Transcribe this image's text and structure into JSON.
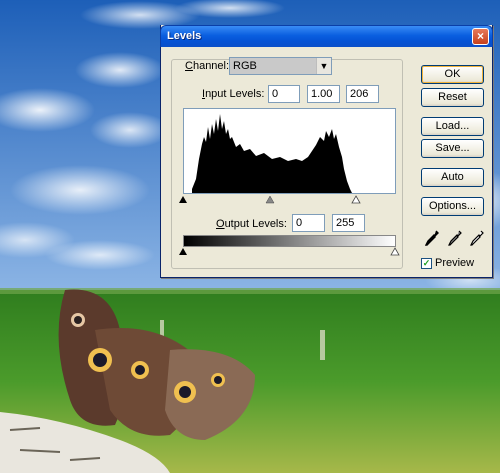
{
  "dialog": {
    "title": "Levels",
    "close_glyph": "×",
    "channel_label_prefix": "",
    "channel_label_ul": "C",
    "channel_label_rest": "hannel:",
    "channel_value": "RGB",
    "input_label_ul": "I",
    "input_label_rest": "nput Levels:",
    "input_levels": [
      "0",
      "1.00",
      "206"
    ],
    "output_label_ul": "O",
    "output_label_rest": "utput Levels:",
    "output_levels": [
      "0",
      "255"
    ],
    "buttons": {
      "ok": "OK",
      "reset": "Reset",
      "load": "Load...",
      "save": "Save...",
      "auto": "Auto",
      "options": "Options..."
    },
    "preview_label": "Preview",
    "preview_checked": true
  },
  "icons": {
    "close": "close-icon",
    "dropdown": "chevron-down-icon",
    "eyedroppers": [
      "black-eyedropper-icon",
      "gray-eyedropper-icon",
      "white-eyedropper-icon"
    ]
  },
  "colors": {
    "titlebar": "#0a5fe0",
    "dialog_bg": "#ece9d8",
    "sky": "#3f7cc9",
    "grass": "#3f8b22"
  }
}
